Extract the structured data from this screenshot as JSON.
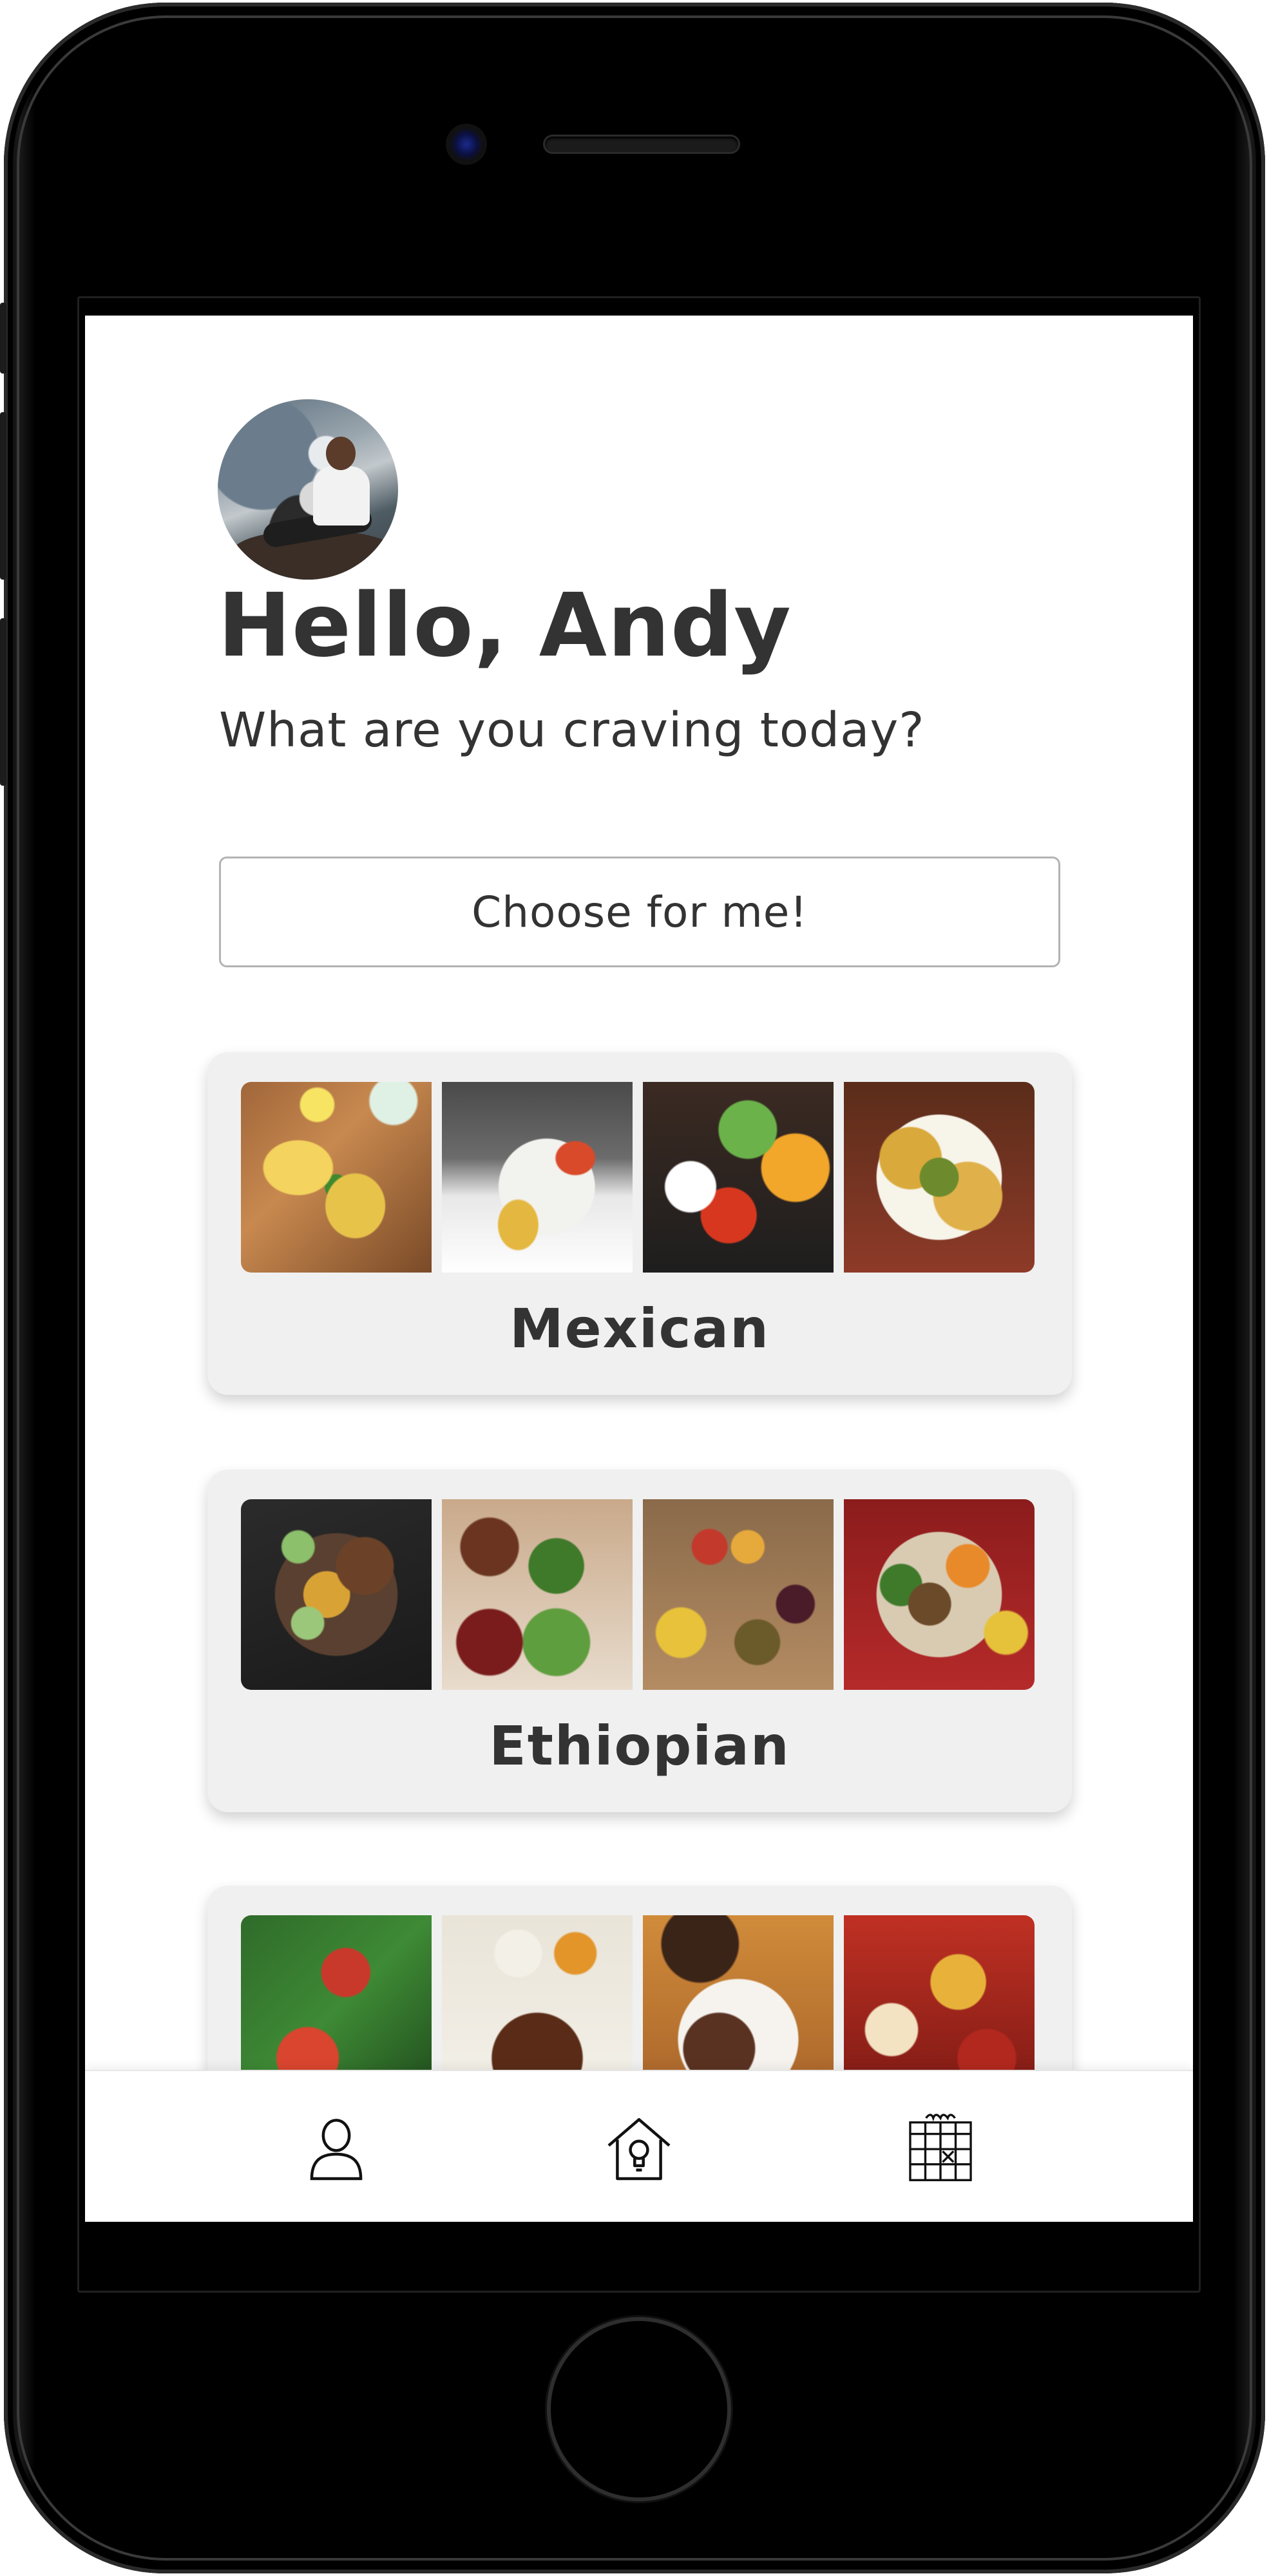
{
  "header": {
    "greeting": "Hello, Andy",
    "subtitle": "What are you craving today?"
  },
  "actions": {
    "choose_label": "Choose for me!"
  },
  "cuisines": [
    {
      "label": "Mexican"
    },
    {
      "label": "Ethiopian"
    },
    {
      "label": ""
    }
  ],
  "tabbar": {
    "items": [
      {
        "icon": "profile-icon"
      },
      {
        "icon": "home-icon"
      },
      {
        "icon": "calendar-icon"
      }
    ]
  },
  "colors": {
    "text": "#333333",
    "card_background": "#f0f0f0",
    "button_border": "#b3b3b3",
    "phone_body": "#000000"
  }
}
